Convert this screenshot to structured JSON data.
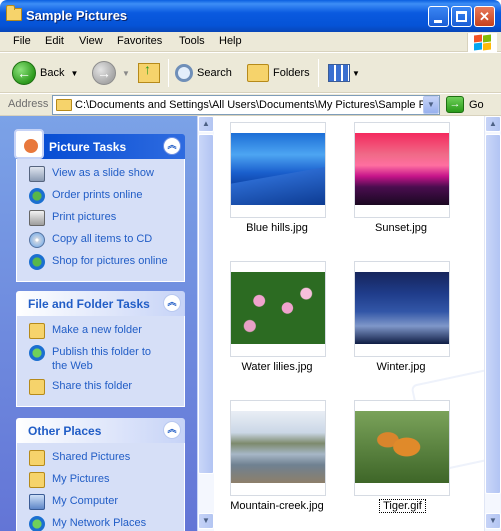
{
  "window": {
    "title": "Sample Pictures"
  },
  "menu": [
    "File",
    "Edit",
    "View",
    "Favorites",
    "Tools",
    "Help"
  ],
  "toolbar": {
    "back_label": "Back",
    "search_label": "Search",
    "folders_label": "Folders"
  },
  "address": {
    "label": "Address",
    "value": "C:\\Documents and Settings\\All Users\\Documents\\My Pictures\\Sample Pictures",
    "go_label": "Go"
  },
  "sidebar": {
    "picture_tasks": {
      "title": "Picture Tasks",
      "items": [
        "View as a slide show",
        "Order prints online",
        "Print pictures",
        "Copy all items to CD",
        "Shop for pictures online"
      ]
    },
    "file_folder_tasks": {
      "title": "File and Folder Tasks",
      "items": [
        "Make a new folder",
        "Publish this folder to the Web",
        "Share this folder"
      ]
    },
    "other_places": {
      "title": "Other Places",
      "items": [
        "Shared Pictures",
        "My Pictures",
        "My Computer",
        "My Network Places"
      ]
    }
  },
  "files": [
    {
      "name": "Blue hills.jpg",
      "selected": false
    },
    {
      "name": "Sunset.jpg",
      "selected": false
    },
    {
      "name": "Water lilies.jpg",
      "selected": false
    },
    {
      "name": "Winter.jpg",
      "selected": false
    },
    {
      "name": "Mountain-creek.jpg",
      "selected": false
    },
    {
      "name": "Tiger.gif",
      "selected": true
    }
  ],
  "colors": {
    "titlebar": "#0a5ae0",
    "task_link": "#215dc6",
    "sidebar_bg": "#7ba2e7",
    "panel_body": "#d6dff7"
  },
  "icons": {
    "toolbar": [
      "back-arrow-icon",
      "forward-arrow-icon",
      "up-folder-icon",
      "search-icon",
      "folders-icon",
      "views-icon"
    ]
  }
}
